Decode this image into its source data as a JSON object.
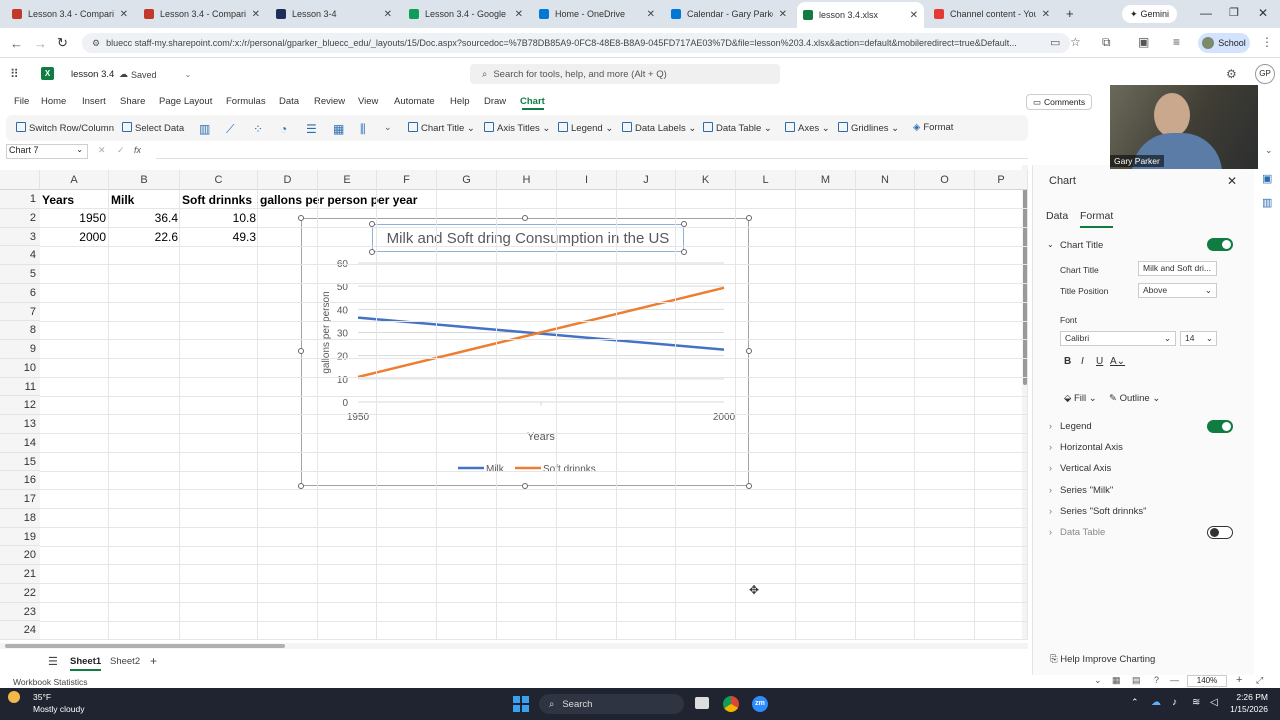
{
  "browser": {
    "tabs": [
      {
        "label": "Lesson 3.4 - Comparing",
        "color": "#c0392b"
      },
      {
        "label": "Lesson 3.4 - Comparing",
        "color": "#c0392b"
      },
      {
        "label": "Lesson 3-4",
        "color": "#1f2d5a"
      },
      {
        "label": "Lesson 3.4 - Google Sh",
        "color": "#0f9d58"
      },
      {
        "label": "Home - OneDrive",
        "color": "#0078d4"
      },
      {
        "label": "Calendar - Gary Parker",
        "color": "#0078d4"
      },
      {
        "label": "lesson 3.4.xlsx",
        "color": "#107c41"
      },
      {
        "label": "Channel content - YouT",
        "color": "#e53935"
      }
    ],
    "active_tab_index": 6,
    "gemini_label": "Gemini",
    "url": "bluecc staff-my.sharepoint.com/:x:/r/personal/gparker_bluecc_edu/_layouts/15/Doc.aspx?sourcedoc=%7B78DB85A9-0FC8-48E8-B8A9-045FD717AE03%7D&file=lesson%203.4.xlsx&action=default&mobileredirect=true&Default...",
    "profile_label": "School"
  },
  "excel": {
    "file_name": "lesson 3.4",
    "saved_status": "Saved",
    "search_placeholder": "Search for tools, help, and more (Alt + Q)",
    "user_initials": "GP",
    "menu": [
      "File",
      "Home",
      "Insert",
      "Share",
      "Page Layout",
      "Formulas",
      "Data",
      "Review",
      "View",
      "Automate",
      "Help",
      "Draw",
      "Chart"
    ],
    "active_menu": "Chart",
    "comments_label": "Comments",
    "ribbon": {
      "switch_row_col": "Switch Row/Column",
      "select_data": "Select Data",
      "chart_title": "Chart Title",
      "axis_titles": "Axis Titles",
      "legend": "Legend",
      "data_labels": "Data Labels",
      "data_table": "Data Table",
      "axes": "Axes",
      "gridlines": "Gridlines",
      "format": "Format"
    },
    "name_box": "Chart 7",
    "fx": "fx"
  },
  "sheet": {
    "columns": [
      "A",
      "B",
      "C",
      "D",
      "E",
      "F",
      "G",
      "H",
      "I",
      "J",
      "K",
      "L",
      "M",
      "N",
      "O",
      "P"
    ],
    "rows": [
      "1",
      "2",
      "3",
      "4",
      "5",
      "6",
      "7",
      "8",
      "9",
      "10",
      "11",
      "12",
      "13",
      "14",
      "15",
      "16",
      "17",
      "18",
      "19",
      "20",
      "21",
      "22",
      "23",
      "24"
    ],
    "A1": "Years",
    "B1": "Milk",
    "C1": "Soft drinnks",
    "D1": "gallons per person per year",
    "A2": "1950",
    "B2": "36.4",
    "C2": "10.8",
    "A3": "2000",
    "B3": "22.6",
    "C3": "49.3",
    "tabs": [
      "Sheet1",
      "Sheet2"
    ],
    "active_tab": "Sheet1",
    "status_left": "Workbook Statistics",
    "zoom": "140%"
  },
  "chart_data": {
    "type": "line",
    "title": "Milk and Soft dring Consumption in the US",
    "xlabel": "Years",
    "ylabel": "gallons per person",
    "categories": [
      "1950",
      "2000"
    ],
    "series": [
      {
        "name": "Milk",
        "values": [
          36.4,
          22.6
        ],
        "color": "#4472c4"
      },
      {
        "name": "Soft drinnks",
        "values": [
          10.8,
          49.3
        ],
        "color": "#ed7d31"
      }
    ],
    "ylim": [
      0,
      60
    ],
    "yticks": [
      "0",
      "10",
      "20",
      "30",
      "40",
      "50",
      "60"
    ],
    "grid": true,
    "legend_position": "bottom"
  },
  "pane": {
    "title": "Chart",
    "tabs": [
      "Data",
      "Format"
    ],
    "active_tab": "Format",
    "section_chart_title": "Chart Title",
    "chart_title_label": "Chart Title",
    "chart_title_value": "Milk and Soft dri...",
    "title_position_label": "Title Position",
    "title_position_value": "Above",
    "font_label": "Font",
    "font_name": "Calibri",
    "font_size": "14",
    "fill_label": "Fill",
    "outline_label": "Outline",
    "sections": [
      "Legend",
      "Horizontal Axis",
      "Vertical Axis",
      "Series \"Milk\"",
      "Series \"Soft drinnks\"",
      "Data Table"
    ],
    "help_label": "Help Improve Charting"
  },
  "video": {
    "name": "Gary Parker"
  },
  "taskbar": {
    "temp": "35°F",
    "weather": "Mostly cloudy",
    "search": "Search",
    "time": "2:26 PM",
    "date": "1/15/2026"
  }
}
